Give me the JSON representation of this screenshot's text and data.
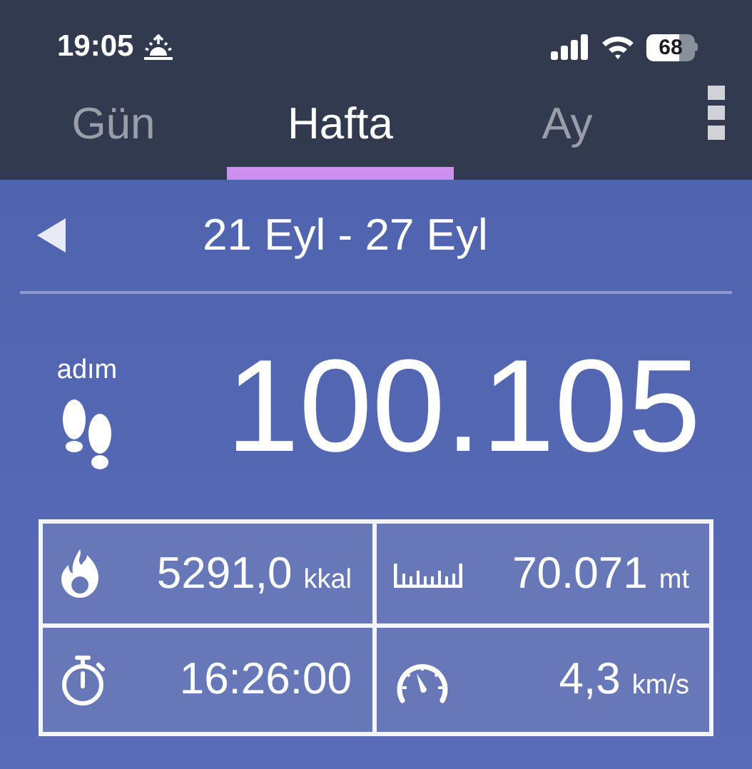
{
  "status_bar": {
    "time": "19:05",
    "battery": "68"
  },
  "tabs": [
    {
      "label": "Gün",
      "selected": false
    },
    {
      "label": "Hafta",
      "selected": true
    },
    {
      "label": "Ay",
      "selected": false
    }
  ],
  "date_range": "21 Eyl - 27 Eyl",
  "steps": {
    "label": "adım",
    "value": "100.105"
  },
  "stats": [
    {
      "kind": "calories",
      "value": "5291,0",
      "unit": "kkal"
    },
    {
      "kind": "distance",
      "value": "70.071",
      "unit": "mt"
    },
    {
      "kind": "duration",
      "value": "16:26:00"
    },
    {
      "kind": "speed",
      "value": "4,3",
      "unit": "km/s"
    }
  ]
}
